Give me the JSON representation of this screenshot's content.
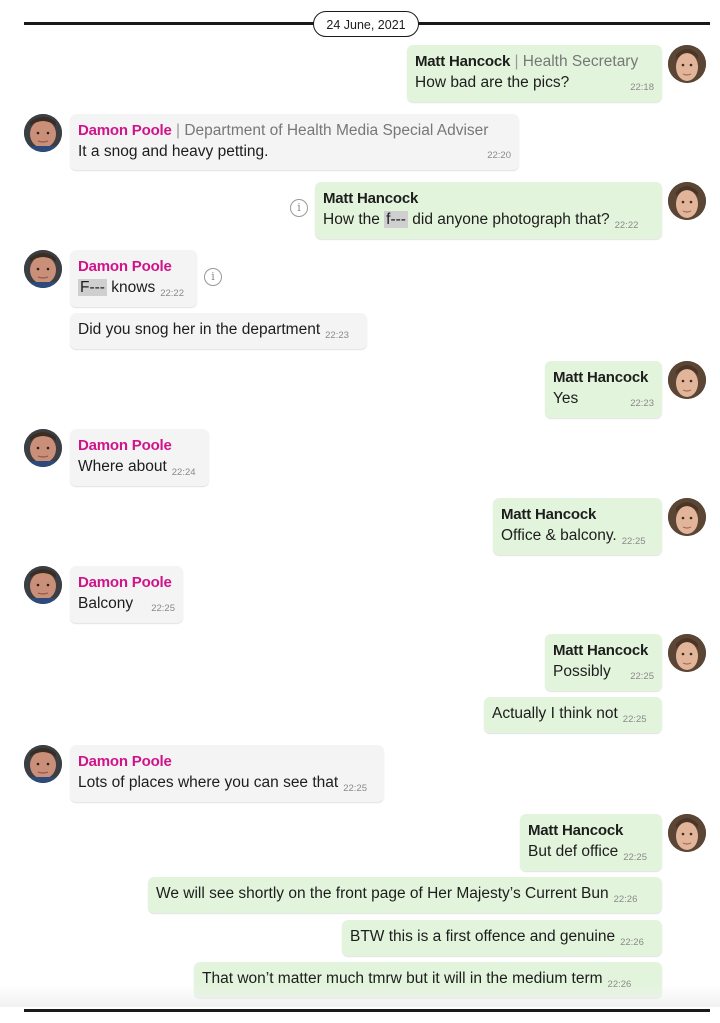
{
  "date_separator": "24 June, 2021",
  "matt": {
    "name": "Matt Hancock",
    "role": "Health Secretary"
  },
  "damon": {
    "name": "Damon Poole",
    "role": "Department of Health Media Special Adviser"
  },
  "info_glyph": "i",
  "messages": [
    {
      "text": "How bad are the pics?",
      "time": "22:18"
    },
    {
      "text": "It a snog and heavy petting.",
      "time": "22:20"
    },
    {
      "pre": "How the ",
      "censored": "f---",
      "post": " did anyone photograph that?",
      "time": "22:22"
    },
    {
      "censored": "F---",
      "post": " knows",
      "time": "22:22"
    },
    {
      "text": "Did you snog her in the department",
      "time": "22:23"
    },
    {
      "text": "Yes",
      "time": "22:23"
    },
    {
      "text": "Where about",
      "time": "22:24"
    },
    {
      "text": "Office & balcony.",
      "time": "22:25"
    },
    {
      "text": "Balcony",
      "time": "22:25"
    },
    {
      "text": "Possibly",
      "time": "22:25"
    },
    {
      "text": "Actually I think not",
      "time": "22:25"
    },
    {
      "text": "Lots of places where you can see that",
      "time": "22:25"
    },
    {
      "text": "But def office",
      "time": "22:25"
    },
    {
      "text": "We will see shortly on the front page of Her Majesty’s Current Bun",
      "time": "22:26"
    },
    {
      "text": "BTW this is a first offence and genuine",
      "time": "22:26"
    },
    {
      "text": "That won’t matter much tmrw but it will in the medium term",
      "time": "22:26"
    }
  ]
}
